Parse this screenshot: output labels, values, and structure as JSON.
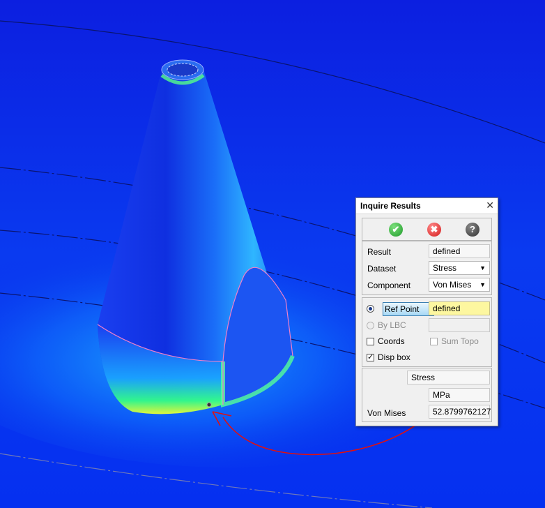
{
  "dialog": {
    "title": "Inquire Results",
    "close_glyph": "✕",
    "actions": [
      {
        "name": "ok",
        "icon": "checkmark-icon",
        "glyph": "✔",
        "color": "#1f9a2a"
      },
      {
        "name": "cancel",
        "icon": "cancel-icon",
        "glyph": "✖",
        "color": "#d41b1b"
      },
      {
        "name": "help",
        "icon": "help-icon",
        "glyph": "?",
        "color": "#333333"
      }
    ],
    "result": {
      "label": "Result",
      "value": "defined"
    },
    "dataset": {
      "label": "Dataset",
      "value": "Stress"
    },
    "component": {
      "label": "Component",
      "value": "Von Mises"
    },
    "ref_point": {
      "label": "Ref Point",
      "value": "defined",
      "selected": true
    },
    "by_lbc": {
      "label": "By LBC",
      "value": "",
      "enabled": false
    },
    "coords": {
      "label": "Coords",
      "checked": false
    },
    "sum_topo": {
      "label": "Sum Topo",
      "checked": false,
      "enabled": false
    },
    "disp_box": {
      "label": "Disp box",
      "checked": true
    },
    "output": {
      "type": "Stress",
      "unit": "MPa",
      "label": "Von Mises",
      "value": "52.8799762127"
    }
  },
  "colors": {
    "background": "#0a2ee6",
    "highlight_field": "#fdf7a0",
    "annotation_arrow": "#e01010"
  }
}
